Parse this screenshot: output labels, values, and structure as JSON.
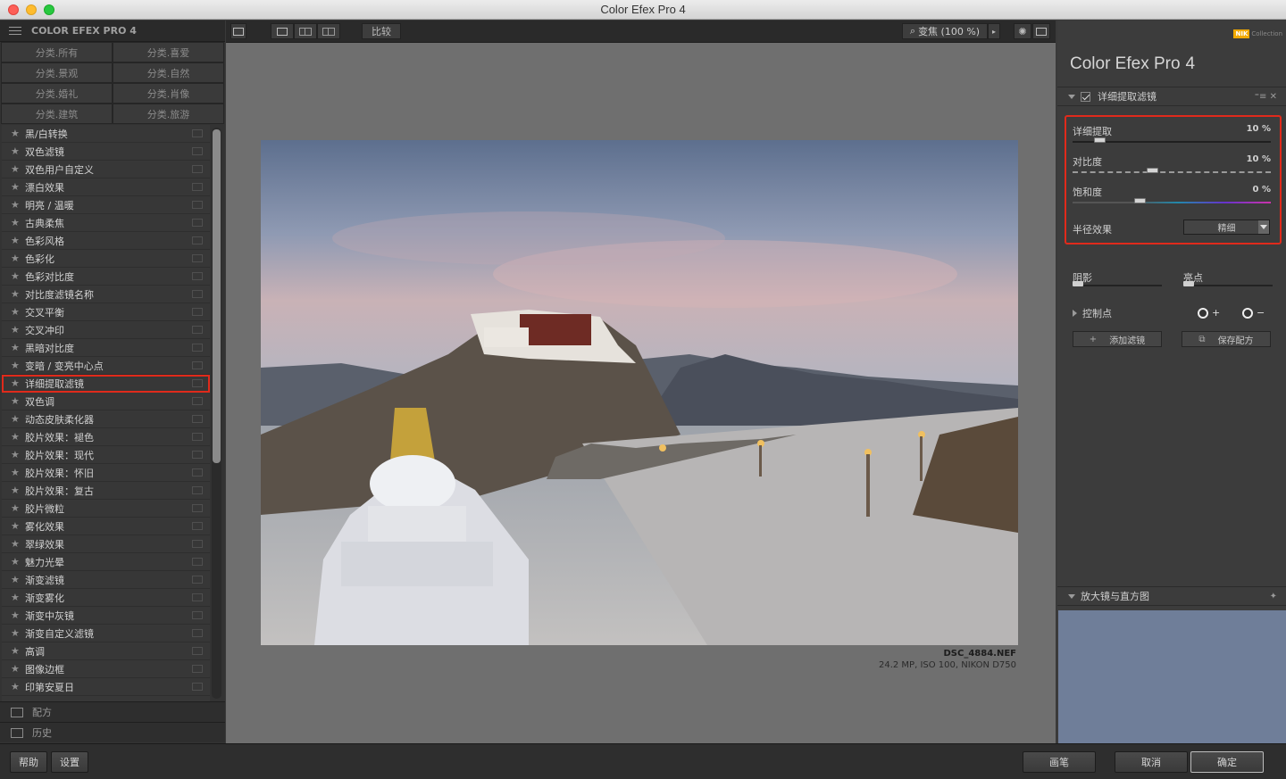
{
  "window": {
    "title": "Color Efex Pro 4"
  },
  "left_panel": {
    "header": "COLOR EFEX PRO 4",
    "categories": [
      "分类.所有",
      "分类.喜爱",
      "分类.景观",
      "分类.自然",
      "分类.婚礼",
      "分类.肖像",
      "分类.建筑",
      "分类.旅游"
    ],
    "filters": [
      "黑/白转换",
      "双色滤镜",
      "双色用户自定义",
      "漂白效果",
      "明亮 / 温暖",
      "古典柔焦",
      "色彩风格",
      "色彩化",
      "色彩对比度",
      "对比度滤镜名称",
      "交叉平衡",
      "交叉冲印",
      "黑暗对比度",
      "变暗 / 变亮中心点",
      "详细提取滤镜",
      "双色调",
      "动态皮肤柔化器",
      "胶片效果：褪色",
      "胶片效果：现代",
      "胶片效果：怀旧",
      "胶片效果：复古",
      "胶片微粒",
      "雾化效果",
      "翠绿效果",
      "魅力光晕",
      "渐变滤镜",
      "渐变雾化",
      "渐变中灰镜",
      "渐变自定义滤镜",
      "高调",
      "图像边框",
      "印第安夏日"
    ],
    "selected_filter": "详细提取滤镜",
    "recipes_label": "配方",
    "history_label": "历史"
  },
  "toolbar": {
    "compare_label": "比较",
    "zoom_label": "变焦 (100 %)"
  },
  "image": {
    "filename": "DSC_4884.NEF",
    "info": "24.2 MP, ISO 100, NIKON D750"
  },
  "right_panel": {
    "brand": "NIK",
    "brand_sub": "Collection",
    "title": "Color Efex Pro",
    "title_version": "4",
    "filter_section": "详细提取滤镜",
    "controls": [
      {
        "name": "详细提取",
        "value": "10 %",
        "level": 0.1
      },
      {
        "name": "对比度",
        "value": "10 %",
        "level": 0.4
      },
      {
        "name": "饱和度",
        "value": "0 %",
        "level": 0.34
      }
    ],
    "radius_label": "半径效果",
    "radius_value": "精细",
    "shadows_label": "阴影",
    "highlights_label": "亮点",
    "control_points_label": "控制点",
    "add_filter_label": "添加滤镜",
    "save_recipe_label": "保存配方",
    "loupe_label": "放大镜与直方图"
  },
  "bottom": {
    "help": "帮助",
    "settings": "设置",
    "brush": "画笔",
    "cancel": "取消",
    "ok": "确定"
  },
  "colors": {
    "highlight": "#e02a1b",
    "accent_brand": "#f2a900"
  }
}
